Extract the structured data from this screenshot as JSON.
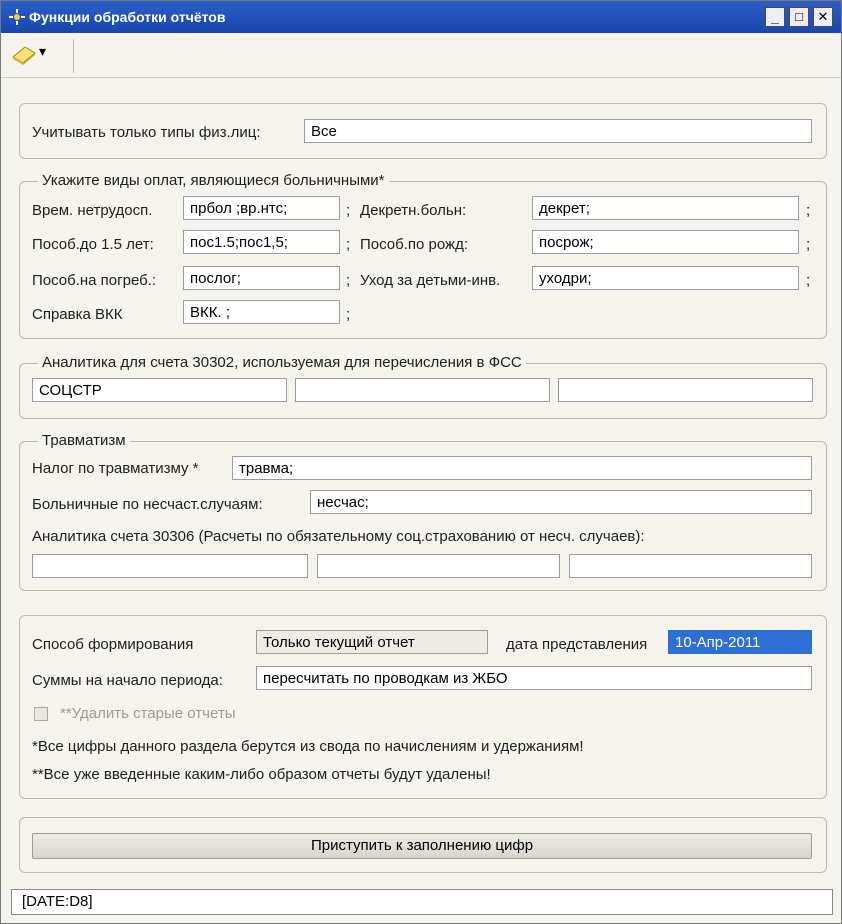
{
  "window": {
    "title": "Функции обработки отчётов",
    "controls": {
      "minimize": "_",
      "maximize": "□",
      "close": "✕"
    }
  },
  "toolbar": {
    "icon": "document-pencil-icon",
    "dropdown": "▾"
  },
  "person_types": {
    "label": "Учитывать только типы физ.лиц:",
    "value": "Все"
  },
  "sick_payments": {
    "legend": "Укажите виды оплат, являющиеся больничными*",
    "rows": [
      {
        "label": "Врем. нетрудосп.",
        "value": "прбол ;вр.нтс;",
        "sep": ";"
      },
      {
        "label": "Пособ.до 1.5 лет:",
        "value": "пос1.5;пос1,5;",
        "sep": ";"
      },
      {
        "label": "Пособ.на погреб.:",
        "value": "послог;",
        "sep": ";"
      },
      {
        "label": "Справка ВКК",
        "value": "ВКК.  ;",
        "sep": ";"
      }
    ],
    "rows_right": [
      {
        "label": "Декретн.больн:",
        "value": "декрет;",
        "sep": ";"
      },
      {
        "label": "Пособ.по рожд:",
        "value": "посрож;",
        "sep": ";"
      },
      {
        "label": "Уход за детьми-инв.",
        "value": "уходри;",
        "sep": ";"
      }
    ]
  },
  "analytics_30302": {
    "legend": "Аналитика для счета 30302, используемая для перечисления в ФСС",
    "fields": [
      "СОЦСТР",
      "",
      ""
    ]
  },
  "injury": {
    "legend": "Травматизм",
    "tax_label": "Налог по травматизму *",
    "tax_value": "травма;",
    "sick_label": "Больничные по несчаст.случаям:",
    "sick_value": "несчас;",
    "analytics_label": "Аналитика счета 30306 (Расчеты по обязательному соц.страхованию от несч. случаев):",
    "analytics_fields": [
      "",
      "",
      ""
    ]
  },
  "generation": {
    "method_label": "Способ формирования",
    "method_value": "Только текущий отчет",
    "date_label": "дата представления",
    "date_value": "10-Апр-2011",
    "sums_label": "Суммы на начало периода:",
    "sums_value": "пересчитать по проводкам из ЖБО",
    "delete_label": "**Удалить старые отчеты",
    "delete_checked": false,
    "note1": "*Все цифры данного раздела берутся из свода по начислениям и удержаниям!",
    "note2": "**Все уже введенные каким-либо образом отчеты будут удалены!"
  },
  "action": {
    "start_label": "Приступить к заполнению цифр"
  },
  "status": {
    "text": "[DATE:D8]"
  }
}
